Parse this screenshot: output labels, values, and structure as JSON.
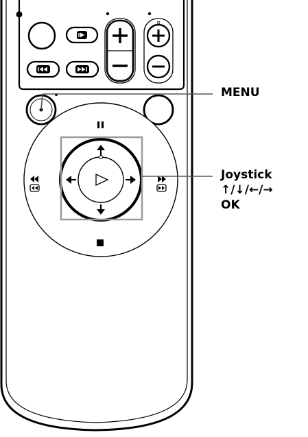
{
  "callouts": {
    "menu": "MENU",
    "joystick_title": "Joystick",
    "joystick_arrows": "↑/↓/←/→",
    "joystick_ok": "OK"
  },
  "icons": {
    "pause": "pause-icon",
    "stop": "stop-icon",
    "rewind": "rewind-icon",
    "fast_forward": "fast-forward-icon",
    "play": "play-icon",
    "previous": "previous-icon",
    "next": "next-icon",
    "plus": "plus-icon",
    "minus": "minus-icon"
  },
  "colors": {
    "line": "#000000",
    "background": "#ffffff",
    "leader_line": "#555555",
    "highlight_box": "#9a9a9a"
  }
}
